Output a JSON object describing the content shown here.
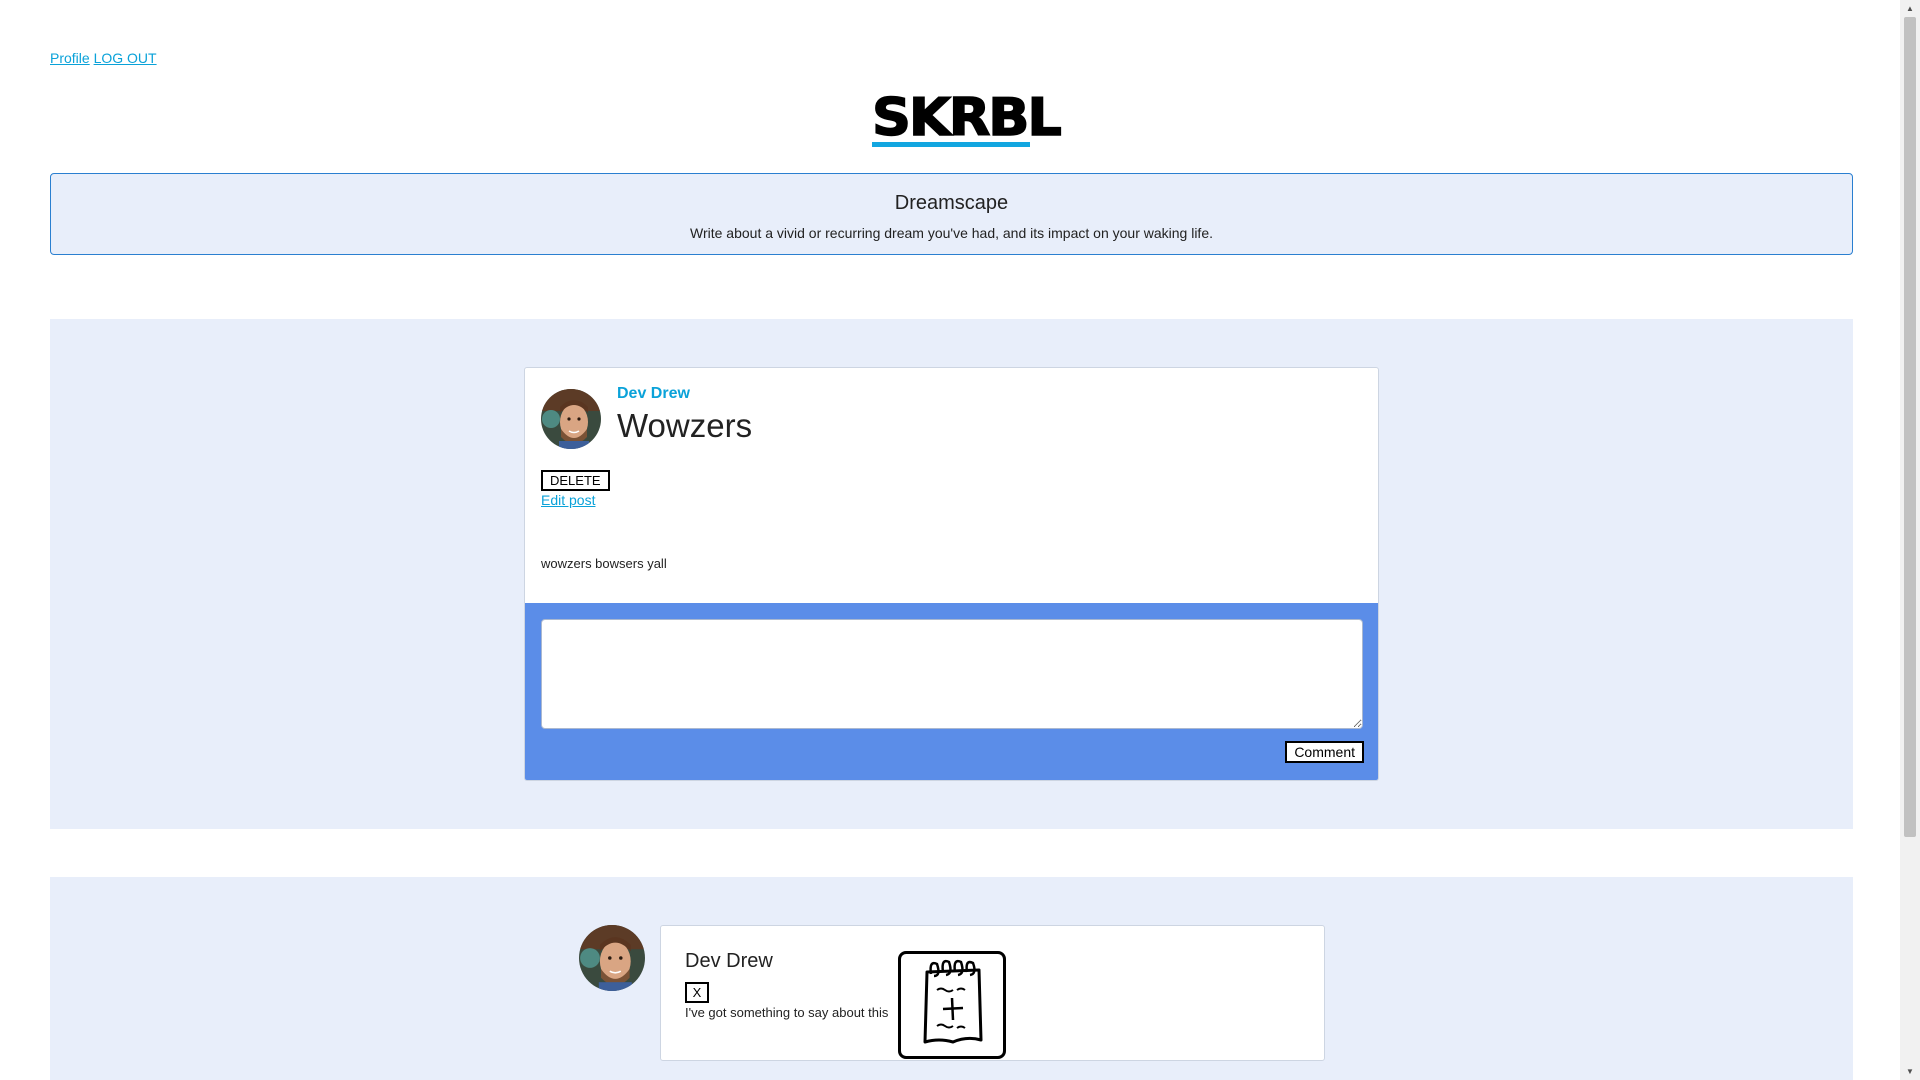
{
  "nav": {
    "profile_label": "Profile",
    "logout_label": "LOG OUT"
  },
  "logo": {
    "text": "SKRBL",
    "underline_color": "#12a6e0"
  },
  "prompt": {
    "title": "Dreamscape",
    "description": "Write about a vivid or recurring dream you've had, and its impact on your waking life."
  },
  "post": {
    "author": "Dev Drew",
    "title": "Wowzers",
    "delete_label": "DELETE",
    "edit_label": "Edit post",
    "body": "wowzers bowsers yall",
    "comment_input_value": "",
    "comment_button_label": "Comment"
  },
  "comments": [
    {
      "author": "Dev Drew",
      "delete_label": "X",
      "text": "I've got something to say about this"
    }
  ],
  "icons": {
    "notes": "notepad-icon",
    "avatar": "user-avatar"
  },
  "colors": {
    "link": "#0aa2d9",
    "section_bg": "#e8eefa",
    "comment_area_bg": "#5b8de8",
    "prompt_border": "#2a7fd0"
  }
}
